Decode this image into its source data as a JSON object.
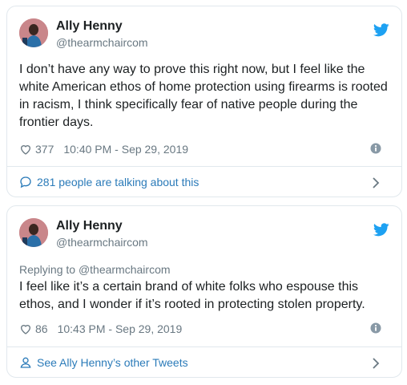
{
  "colors": {
    "link": "#2b7bb9",
    "secondary_text": "#697882",
    "primary_text": "#1c2022",
    "border": "#e1e8ed",
    "twitter_blue": "#1da1f2"
  },
  "tweets": [
    {
      "author": {
        "name": "Ally Henny",
        "handle": "@thearmchaircom",
        "avatar_icon": "avatar-photo",
        "platform_icon": "twitter-bird-icon"
      },
      "text": "I don’t have any way to prove this right now, but I feel like the white American ethos of home protection using firearms is rooted in racism, I think specifically fear of native people during the frontier days.",
      "likes": "377",
      "timestamp": "10:40 PM - Sep 29, 2019",
      "footer": {
        "label": "281 people are talking about this",
        "icon": "comment-bubble-icon"
      }
    },
    {
      "author": {
        "name": "Ally Henny",
        "handle": "@thearmchaircom",
        "avatar_icon": "avatar-photo",
        "platform_icon": "twitter-bird-icon"
      },
      "replying_prefix": "Replying to",
      "replying_to": "@thearmchaircom",
      "text": "I feel like it’s a certain brand of white folks who espouse this ethos, and I wonder if it’s rooted in protecting stolen property.",
      "likes": "86",
      "timestamp": "10:43 PM - Sep 29, 2019",
      "footer": {
        "label": "See Ally Henny’s other Tweets",
        "icon": "person-icon"
      }
    }
  ]
}
